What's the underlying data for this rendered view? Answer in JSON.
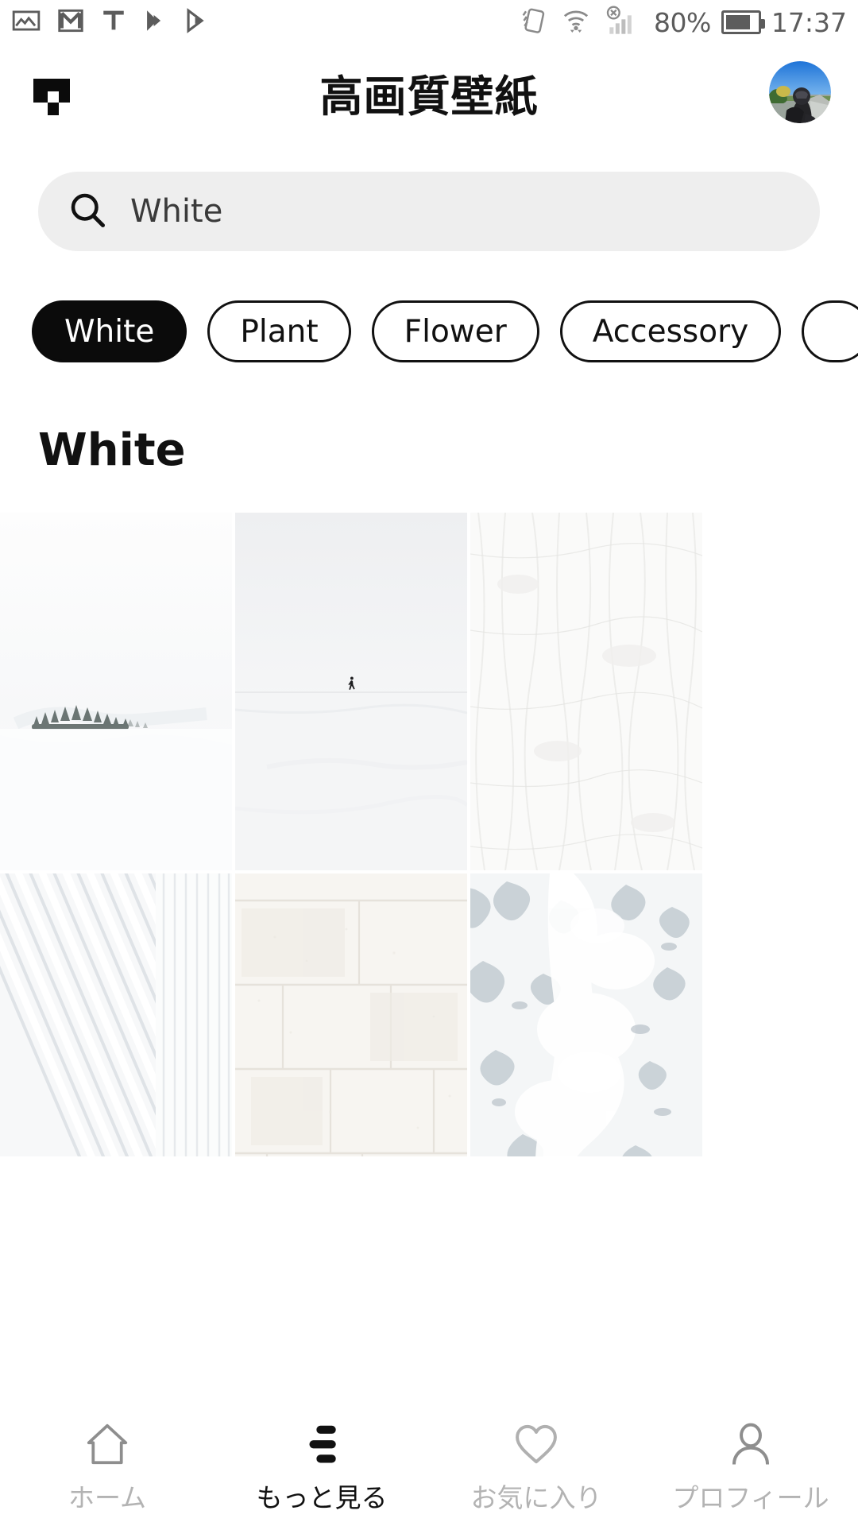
{
  "status_bar": {
    "notification_icons": [
      "photo-icon",
      "gmail-icon",
      "text-icon",
      "play-movies-icon",
      "play-store-icon"
    ],
    "system_icons": [
      "rotate-icon",
      "wifi-icon",
      "signal-off-icon"
    ],
    "battery_percent": "80%",
    "battery_icon": "battery-icon",
    "clock": "17:37"
  },
  "header": {
    "logo_icon": "app-logo-icon",
    "title": "高画質壁紙",
    "avatar_icon": "user-avatar",
    "avatar_description": "motorcycle rider photo"
  },
  "search": {
    "icon": "search-icon",
    "value": "White",
    "placeholder": "White"
  },
  "chips": [
    {
      "label": "White",
      "selected": true
    },
    {
      "label": "Plant",
      "selected": false
    },
    {
      "label": "Flower",
      "selected": false
    },
    {
      "label": "Accessory",
      "selected": false
    },
    {
      "label": "",
      "selected": false
    }
  ],
  "section": {
    "title": "White"
  },
  "grid": {
    "tiles": [
      {
        "name": "wallpaper-foggy-forest",
        "description": "foggy white forest treeline"
      },
      {
        "name": "wallpaper-snow-walker",
        "description": "lone person walking in snow"
      },
      {
        "name": "wallpaper-white-plaster",
        "description": "white plaster wall texture"
      },
      {
        "name": "wallpaper-white-ribs",
        "description": "white architectural ribbed ceiling"
      },
      {
        "name": "wallpaper-white-brick",
        "description": "white painted cinder block wall"
      },
      {
        "name": "wallpaper-sea-foam",
        "description": "white sea foam wave"
      }
    ]
  },
  "bottom_nav": [
    {
      "label": "ホーム",
      "icon": "home-icon",
      "active": false
    },
    {
      "label": "もっと見る",
      "icon": "more-lines-icon",
      "active": true
    },
    {
      "label": "お気に入り",
      "icon": "heart-icon",
      "active": false
    },
    {
      "label": "プロフィール",
      "icon": "person-icon",
      "active": false
    }
  ],
  "colors": {
    "accent": "#0b0b0b",
    "search_bg": "#eeeeee",
    "status_gray": "#5c5c5c",
    "nav_inactive": "#b3b3b3"
  }
}
